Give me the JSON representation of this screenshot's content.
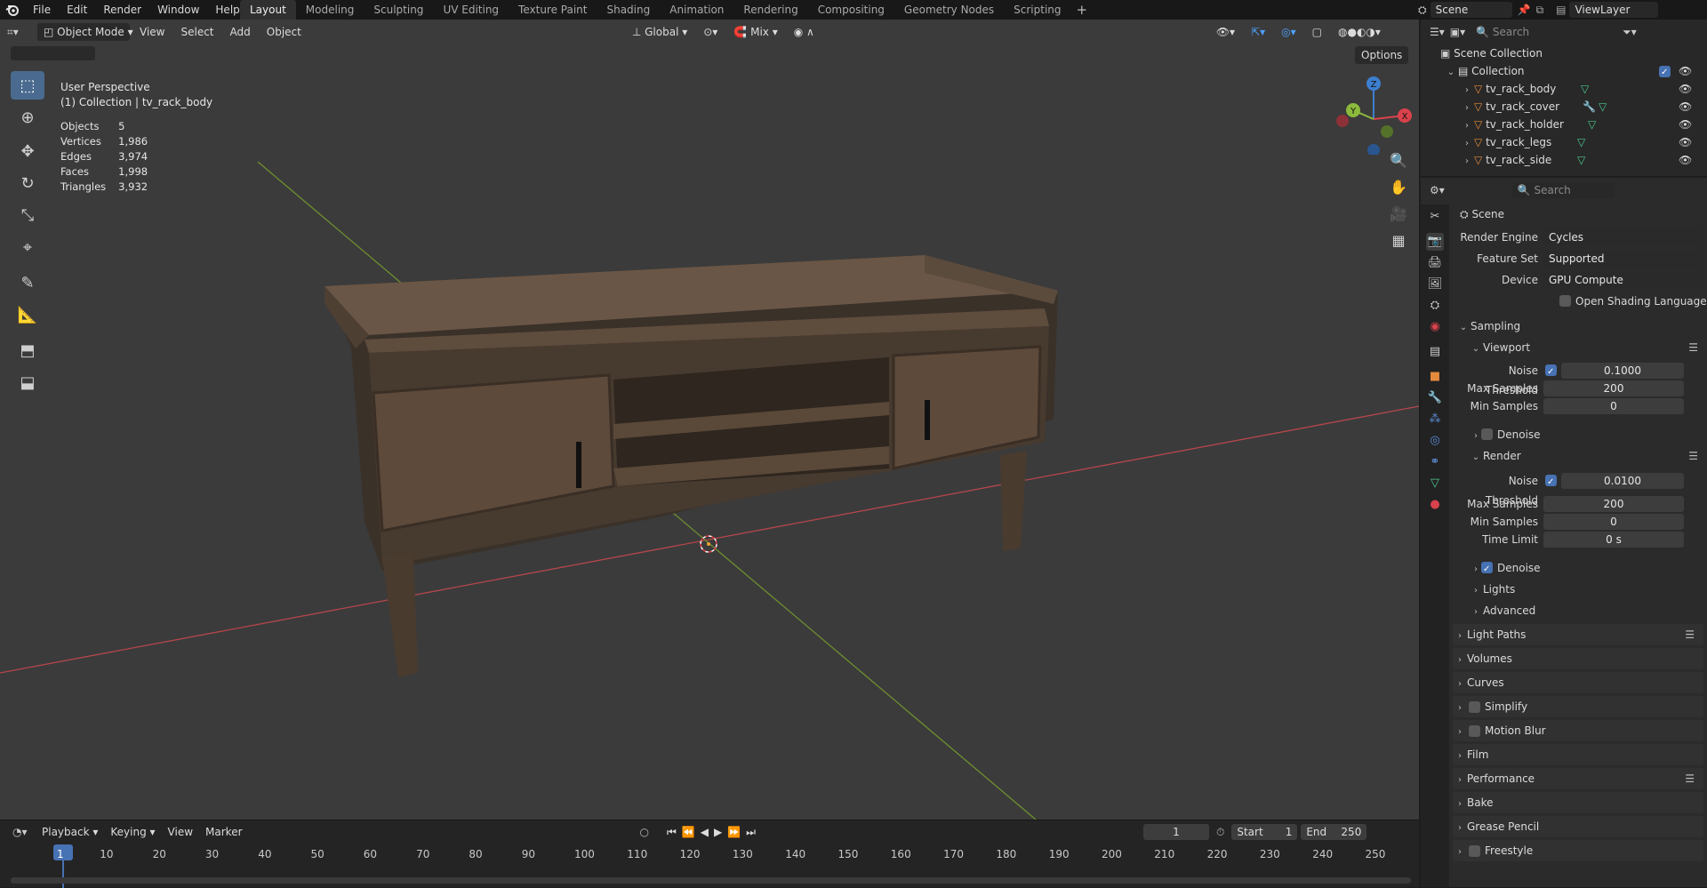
{
  "menu": {
    "items": [
      "File",
      "Edit",
      "Render",
      "Window",
      "Help"
    ],
    "workspaces": [
      "Layout",
      "Modeling",
      "Sculpting",
      "UV Editing",
      "Texture Paint",
      "Shading",
      "Animation",
      "Rendering",
      "Compositing",
      "Geometry Nodes",
      "Scripting"
    ],
    "active_workspace": "Layout",
    "add_tab": "+"
  },
  "topright": {
    "scene": "Scene",
    "view_layer": "ViewLayer"
  },
  "viewport": {
    "mode": "Object Mode",
    "menus": [
      "View",
      "Select",
      "Add",
      "Object"
    ],
    "orientation": "Global",
    "snap_mode": "Mix",
    "options_label": "Options",
    "view_name": "User Perspective",
    "collection_info": "(1) Collection | tv_rack_body",
    "stats": [
      {
        "label": "Objects",
        "value": "5"
      },
      {
        "label": "Vertices",
        "value": "1,986"
      },
      {
        "label": "Edges",
        "value": "3,974"
      },
      {
        "label": "Faces",
        "value": "1,998"
      },
      {
        "label": "Triangles",
        "value": "3,932"
      }
    ],
    "gizmo": {
      "z": "Z",
      "y": "Y",
      "x": "X"
    }
  },
  "timeline": {
    "menus": [
      "Playback",
      "Keying",
      "View",
      "Marker"
    ],
    "current_frame": "1",
    "start_label": "Start",
    "start": "1",
    "end_label": "End",
    "end": "250",
    "ticks": [
      "1",
      "10",
      "20",
      "30",
      "40",
      "50",
      "60",
      "70",
      "80",
      "90",
      "100",
      "110",
      "120",
      "130",
      "140",
      "150",
      "160",
      "170",
      "180",
      "190",
      "200",
      "210",
      "220",
      "230",
      "240",
      "250"
    ]
  },
  "outliner": {
    "search_placeholder": "Search",
    "scene_collection": "Scene Collection",
    "collection": "Collection",
    "objects": [
      "tv_rack_body",
      "tv_rack_cover",
      "tv_rack_holder",
      "tv_rack_legs",
      "tv_rack_side"
    ]
  },
  "properties": {
    "search_placeholder": "Search",
    "context": "Scene",
    "render_engine_label": "Render Engine",
    "render_engine": "Cycles",
    "feature_set_label": "Feature Set",
    "feature_set": "Supported",
    "device_label": "Device",
    "device": "GPU Compute",
    "osl_label": "Open Shading Language",
    "sampling": "Sampling",
    "viewport": "Viewport",
    "noise_threshold_label": "Noise Threshold",
    "viewport_noise": "0.1000",
    "max_samples_label": "Max Samples",
    "viewport_max": "200",
    "min_samples_label": "Min Samples",
    "viewport_min": "0",
    "denoise_label": "Denoise",
    "render": "Render",
    "render_noise": "0.0100",
    "render_max": "200",
    "render_min": "0",
    "time_limit_label": "Time Limit",
    "time_limit": "0 s",
    "lights": "Lights",
    "advanced": "Advanced",
    "panels": [
      "Light Paths",
      "Volumes",
      "Curves",
      "Simplify",
      "Motion Blur",
      "Film",
      "Performance",
      "Bake",
      "Grease Pencil",
      "Freestyle"
    ]
  },
  "colors": {
    "accent": "#4772b3",
    "x_axis": "#d9424c",
    "y_axis": "#8cba3c",
    "z_axis": "#3d7fd0"
  }
}
